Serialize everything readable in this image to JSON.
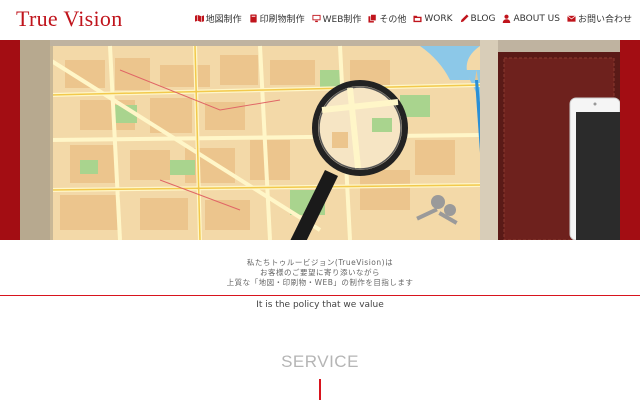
{
  "header": {
    "logo": "True Vision",
    "nav": [
      {
        "label": "地図制作",
        "icon": "map-icon"
      },
      {
        "label": "印刷物制作",
        "icon": "book-icon"
      },
      {
        "label": "WEB制作",
        "icon": "desktop-icon"
      },
      {
        "label": "その他",
        "icon": "files-icon"
      },
      {
        "label": "WORK",
        "icon": "folder-icon"
      },
      {
        "label": "BLOG",
        "icon": "pencil-icon"
      },
      {
        "label": "ABOUT US",
        "icon": "user-icon"
      },
      {
        "label": "お問い合わせ",
        "icon": "envelope-icon"
      }
    ],
    "accent_color": "#c0141c"
  },
  "hero": {
    "image": "city-map-with-magnifying-glass"
  },
  "intro": {
    "lines": [
      "私たちトゥルービジョン(TrueVision)は",
      "お客様のご要望に寄り添いながら",
      "上質な「地図・印刷物・WEB」の制作を目指します"
    ],
    "policy": "It is the policy that we value"
  },
  "service": {
    "title": "SERVICE"
  }
}
